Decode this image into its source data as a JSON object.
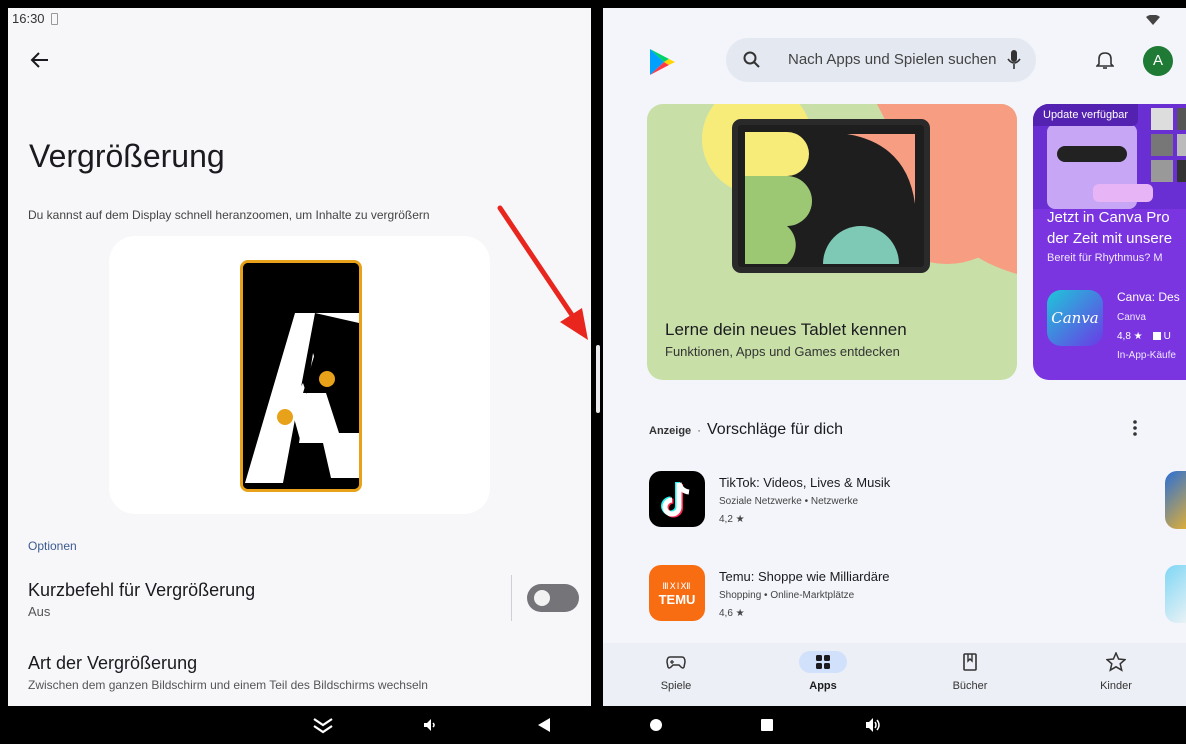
{
  "status_bar": {
    "time": "16:30"
  },
  "settings": {
    "title": "Vergrößerung",
    "description": "Du kannst auf dem Display schnell heranzoomen, um Inhalte zu vergrößern",
    "section_label": "Optionen",
    "shortcut": {
      "title": "Kurzbefehl für Vergrößerung",
      "state": "Aus",
      "enabled": false
    },
    "magnification_type": {
      "title": "Art der Vergrößerung",
      "subtitle": "Zwischen dem ganzen Bildschirm und einem Teil des Bildschirms wechseln"
    }
  },
  "play_store": {
    "search_placeholder": "Nach Apps und Spielen suchen",
    "avatar_letter": "A",
    "banner_main": {
      "title": "Lerne dein neues Tablet kennen",
      "subtitle": "Funktionen, Apps und Games entdecken"
    },
    "banner_canva": {
      "badge": "Update verfügbar",
      "headline1": "Jetzt in Canva Pro",
      "headline2": "der Zeit mit unsere",
      "sub": "Bereit für Rhythmus? M",
      "icon_text": "Canva",
      "app_name": "Canva: Des",
      "developer": "Canva",
      "rating": "4,8 ★",
      "rating_extra": "U",
      "iap": "In-App-Käufe"
    },
    "ad_label": "Anzeige",
    "section_title": "Vorschläge für dich",
    "apps": [
      {
        "name": "TikTok: Videos, Lives & Musik",
        "category": "Soziale Netzwerke • Netzwerke",
        "rating": "4,2 ★"
      },
      {
        "name": "Temu: Shoppe wie Milliardäre",
        "category": "Shopping • Online-Marktplätze",
        "rating": "4,6 ★",
        "icon_text_top": "ⅢⅩⅠⅫ",
        "icon_text": "TEMU"
      }
    ],
    "bottom_nav": [
      {
        "label": "Spiele",
        "icon": "gamepad-icon",
        "active": false
      },
      {
        "label": "Apps",
        "icon": "apps-grid-icon",
        "active": true
      },
      {
        "label": "Bücher",
        "icon": "bookmark-icon",
        "active": false
      },
      {
        "label": "Kinder",
        "icon": "star-icon",
        "active": false
      }
    ]
  },
  "colors": {
    "accent_blue": "#3b5b8e",
    "play_nav_active": "#d2e1fb",
    "canva_purple": "#7a35e0",
    "temu_orange": "#f96d12",
    "annotation_red": "#e8261e"
  }
}
